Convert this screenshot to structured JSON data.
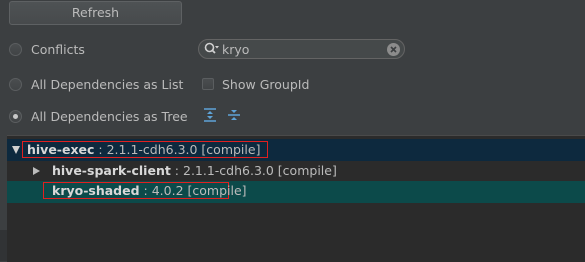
{
  "toolbar": {
    "refresh_label": "Refresh"
  },
  "options": {
    "conflicts_label": "Conflicts",
    "list_label": "All Dependencies as List",
    "tree_label": "All Dependencies as Tree",
    "selected": "All Dependencies as Tree",
    "show_group_id_label": "Show GroupId",
    "show_group_id_checked": false
  },
  "search": {
    "value": "kryo"
  },
  "tree": {
    "nodes": [
      {
        "name": "hive-exec",
        "version": " : 2.1.1-cdh6.3.0 [compile]",
        "expanded": true,
        "highlighted": true
      },
      {
        "name": "hive-spark-client",
        "version": " : 2.1.1-cdh6.3.0 [compile]",
        "expanded": false,
        "highlighted": false
      },
      {
        "name": "kryo-shaded",
        "version": " : 4.0.2 [compile]",
        "expanded": false,
        "highlighted": true
      }
    ]
  },
  "colors": {
    "selection": "#0d293e",
    "match_selection": "#0c4a4a",
    "highlight_box": "#e02020"
  }
}
